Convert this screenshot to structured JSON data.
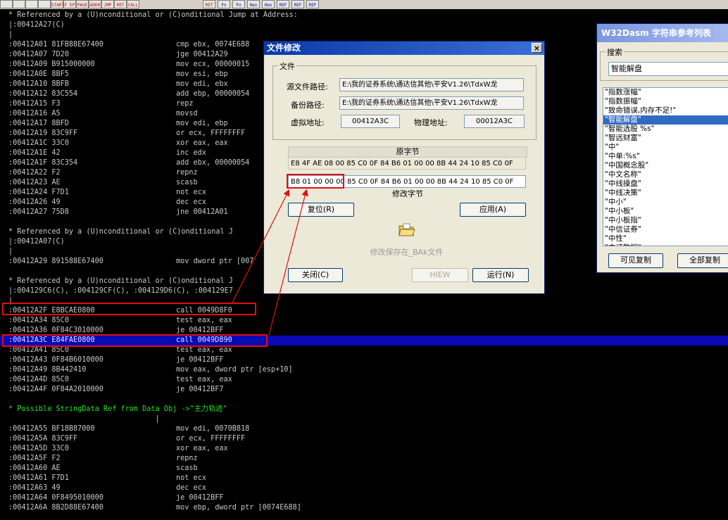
{
  "toolbar": {
    "buttons": [
      {
        "label": "START",
        "icon": "start-icon"
      },
      {
        "label": "F EP",
        "icon": "goto-entry-icon"
      },
      {
        "label": "PAGE",
        "icon": "goto-page-icon"
      },
      {
        "label": "ADDR",
        "icon": "goto-address-icon"
      },
      {
        "label": "JMP",
        "icon": "jump-icon"
      },
      {
        "label": "RET",
        "icon": "return-icon"
      },
      {
        "label": "CALL",
        "icon": "call-icon"
      },
      {
        "label": "RET",
        "icon": "return-call-icon"
      },
      {
        "label": "Fn",
        "icon": "imports-icon"
      },
      {
        "label": "Fn",
        "icon": "exports-icon"
      },
      {
        "label": "Hex",
        "icon": "hex-icon"
      },
      {
        "label": "Hex",
        "icon": "hex-data-icon"
      },
      {
        "label": "REF",
        "icon": "menu-ref-icon"
      },
      {
        "label": "REF",
        "icon": "dialog-ref-icon"
      },
      {
        "label": "REF",
        "icon": "string-ref-icon"
      }
    ]
  },
  "listing": [
    {
      "type": "ref",
      "text": "* Referenced by a (U)nconditional or (C)onditional Jump at Address:"
    },
    {
      "type": "ref",
      "text": "|:00412A27(C)"
    },
    {
      "type": "ref",
      "text": "|"
    },
    {
      "type": "code",
      "addr": ":00412A01 81FB88E67400",
      "ins": "cmp ebx, 0074E688"
    },
    {
      "type": "code",
      "addr": ":00412A07 7D20",
      "ins": "jge 00412A29"
    },
    {
      "type": "code",
      "addr": ":00412A09 B915000000",
      "ins": "mov ecx, 00000015"
    },
    {
      "type": "code",
      "addr": ":00412A0E 8BF5",
      "ins": "mov esi, ebp"
    },
    {
      "type": "code",
      "addr": ":00412A10 8BFB",
      "ins": "mov edi, ebx"
    },
    {
      "type": "code",
      "addr": ":00412A12 83C554",
      "ins": "add ebp, 00000054"
    },
    {
      "type": "code",
      "addr": ":00412A15 F3",
      "ins": "repz"
    },
    {
      "type": "code",
      "addr": ":00412A16 A5",
      "ins": "movsd"
    },
    {
      "type": "code",
      "addr": ":00412A17 8BFD",
      "ins": "mov edi, ebp"
    },
    {
      "type": "code",
      "addr": ":00412A19 83C9FF",
      "ins": "or ecx, FFFFFFFF"
    },
    {
      "type": "code",
      "addr": ":00412A1C 33C0",
      "ins": "xor eax, eax"
    },
    {
      "type": "code",
      "addr": ":00412A1E 42",
      "ins": "inc edx"
    },
    {
      "type": "code",
      "addr": ":00412A1F 83C354",
      "ins": "add ebx, 00000054"
    },
    {
      "type": "code",
      "addr": ":00412A22 F2",
      "ins": "repnz"
    },
    {
      "type": "code",
      "addr": ":00412A23 AE",
      "ins": "scasb"
    },
    {
      "type": "code",
      "addr": ":00412A24 F7D1",
      "ins": "not ecx"
    },
    {
      "type": "code",
      "addr": ":00412A26 49",
      "ins": "dec ecx"
    },
    {
      "type": "code",
      "addr": ":00412A27 75D8",
      "ins": "jne 00412A01"
    },
    {
      "type": "blank",
      "text": ""
    },
    {
      "type": "ref",
      "text": "* Referenced by a (U)nconditional or (C)onditional J"
    },
    {
      "type": "ref",
      "text": "|:00412A07(C)"
    },
    {
      "type": "ref",
      "text": "|"
    },
    {
      "type": "code",
      "addr": ":00412A29 891588E67400",
      "ins": "mov dword ptr [007"
    },
    {
      "type": "blank",
      "text": ""
    },
    {
      "type": "ref",
      "text": "* Referenced by a (U)nconditional or (C)onditional J"
    },
    {
      "type": "ref",
      "text": "|:004129C6(C), :004129CF(C), :004129D6(C), :004129E7"
    },
    {
      "type": "ref",
      "text": "|"
    },
    {
      "type": "code",
      "addr": ":00412A2F E8BCAE0800",
      "ins": "call 0049D8F0"
    },
    {
      "type": "code",
      "addr": ":00412A34 85C0",
      "ins": "test eax, eax"
    },
    {
      "type": "code",
      "addr": ":00412A36 0F84C3010000",
      "ins": "je 00412BFF"
    },
    {
      "type": "sel",
      "addr": ":00412A3C E84FAE0800",
      "ins": "call 0049D890"
    },
    {
      "type": "code",
      "addr": ":00412A41 85C0",
      "ins": "test eax, eax"
    },
    {
      "type": "code",
      "addr": ":00412A43 0F84B6010000",
      "ins": "je 00412BFF"
    },
    {
      "type": "code",
      "addr": ":00412A49 8B442410",
      "ins": "mov eax, dword ptr [esp+10]"
    },
    {
      "type": "code",
      "addr": ":00412A4D 85C0",
      "ins": "test eax, eax"
    },
    {
      "type": "code",
      "addr": ":00412A4F 0F84A2010000",
      "ins": "je 00412BF7"
    },
    {
      "type": "blank",
      "text": ""
    },
    {
      "type": "str",
      "text": "* Possible StringData Ref from Data Obj ->\"主力轨迹\""
    },
    {
      "type": "ref",
      "text": "                                  |"
    },
    {
      "type": "code",
      "addr": ":00412A55 BF18B87000",
      "ins": "mov edi, 0070B818"
    },
    {
      "type": "code",
      "addr": ":00412A5A 83C9FF",
      "ins": "or ecx, FFFFFFFF"
    },
    {
      "type": "code",
      "addr": ":00412A5D 33C0",
      "ins": "xor eax, eax"
    },
    {
      "type": "code",
      "addr": ":00412A5F F2",
      "ins": "repnz"
    },
    {
      "type": "code",
      "addr": ":00412A60 AE",
      "ins": "scasb"
    },
    {
      "type": "code",
      "addr": ":00412A61 F7D1",
      "ins": "not ecx"
    },
    {
      "type": "code",
      "addr": ":00412A63 49",
      "ins": "dec ecx"
    },
    {
      "type": "code",
      "addr": ":00412A64 0F8495010000",
      "ins": "je 00412BFF"
    },
    {
      "type": "code",
      "addr": ":00412A6A 8B2D88E67400",
      "ins": "mov ebp, dword ptr [0074E688]"
    }
  ],
  "dialog": {
    "title": "文件修改",
    "close_label": "×",
    "file_group": "文件",
    "source_label": "源文件路径:",
    "source_path": "E:\\我的证券系统\\通达信其他\\平安V1.26\\TdxW龙",
    "backup_label": "备份路径:",
    "backup_path": "E:\\我的证券系统\\通达信其他\\平安V1.26\\TdxW龙",
    "va_label": "虚拟地址:",
    "va_value": "00412A3C",
    "pa_label": "物理地址:",
    "pa_value": "00012A3C",
    "orig_caption": "原字节",
    "orig_bytes": "E8 4F AE 08 00 85 C0 0F 84 B6 01 00 00 8B 44 24 10 85 C0 0F",
    "mod_bytes_highlight": "B8 01 00 00 00",
    "mod_bytes_rest": "85 C0 0F 84 B6 01 00 00 8B 44 24 10 85 C0 0F",
    "mod_caption": "修改字节",
    "reset_button": "复位(R)",
    "apply_button": "应用(A)",
    "save_note": "修改保存在_BAk文件",
    "close_button": "关闭(C)",
    "hiew_button": "HIEW",
    "run_button": "运行(N)"
  },
  "strings_window": {
    "title": "W32Dasm 字符串参考列表",
    "search_label": "搜索",
    "search_value": "智能解盘",
    "items": [
      "\"指数涨幅\"",
      "\"指数振幅\"",
      "\"致命错误,内存不足!\"",
      "\"智能解盘\"",
      "\"智能选股 %s\"",
      "\"智远财富\"",
      "\"中\"",
      "\"中单:%s\"",
      "\"中国概念股\"",
      "\"中文名称\"",
      "\"中线操盘\"",
      "\"中线决策\"",
      "\"中小\"",
      "\"中小板\"",
      "\"中小板指\"",
      "\"中信证券\"",
      "\"中性\"",
      "\"中证数据\""
    ],
    "selected_index": 3,
    "visible_copy_button": "可见复制",
    "all_copy_button": "全部复制"
  }
}
